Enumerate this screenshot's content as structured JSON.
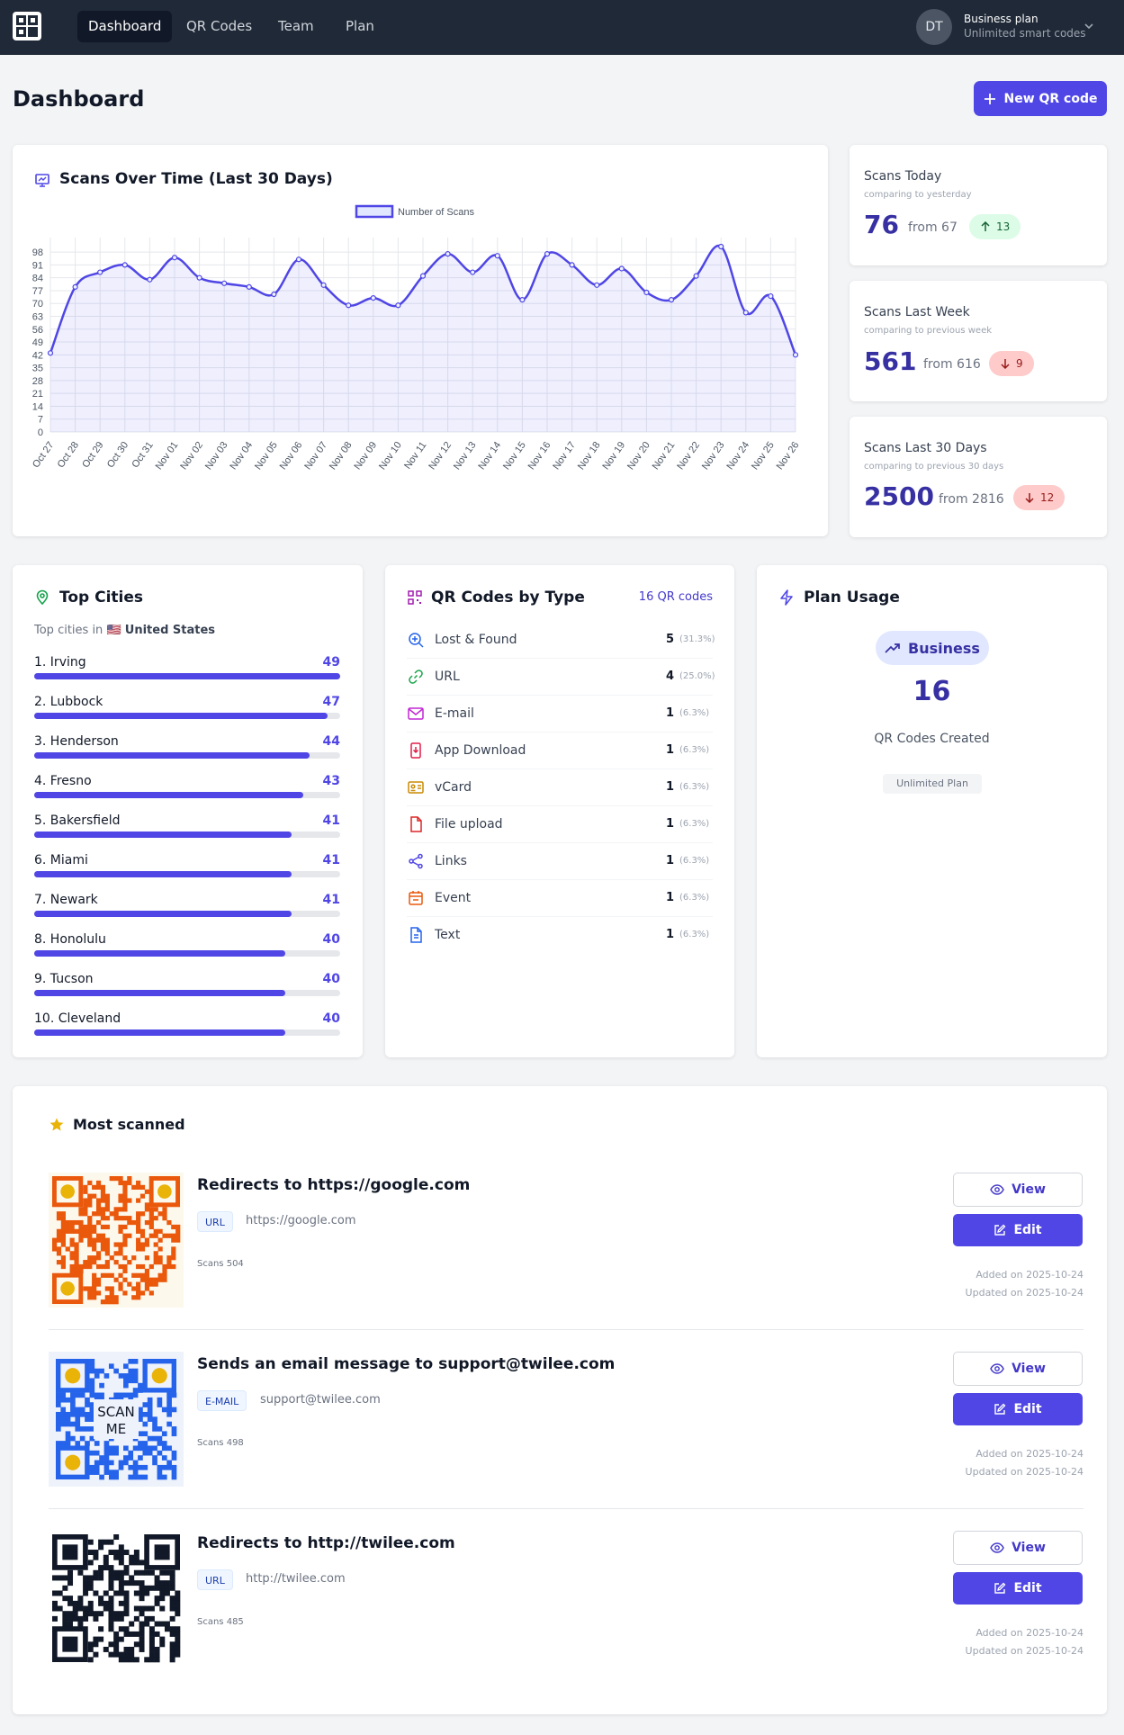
{
  "nav": {
    "links": [
      "Dashboard",
      "QR Codes",
      "Team",
      "Plan"
    ],
    "avatar_initials": "DT",
    "plan_name": "Business plan",
    "plan_sub": "Unlimited smart codes"
  },
  "header": {
    "title": "Dashboard",
    "new_button": "New QR code"
  },
  "scans_chart": {
    "title": "Scans Over Time (Last 30 Days)"
  },
  "chart_data": {
    "type": "area",
    "title": "Scans Over Time (Last 30 Days)",
    "legend": "Number of Scans",
    "legend_position": "top",
    "grid": true,
    "x": [
      "Oct 27",
      "Oct 28",
      "Oct 29",
      "Oct 30",
      "Oct 31",
      "Nov 01",
      "Nov 02",
      "Nov 03",
      "Nov 04",
      "Nov 05",
      "Nov 06",
      "Nov 07",
      "Nov 08",
      "Nov 09",
      "Nov 10",
      "Nov 11",
      "Nov 12",
      "Nov 13",
      "Nov 14",
      "Nov 15",
      "Nov 16",
      "Nov 17",
      "Nov 18",
      "Nov 19",
      "Nov 20",
      "Nov 21",
      "Nov 22",
      "Nov 23",
      "Nov 24",
      "Nov 25",
      "Nov 26"
    ],
    "series": [
      {
        "name": "Number of Scans",
        "values": [
          43,
          79,
          87,
          91,
          83,
          95,
          84,
          81,
          79,
          75,
          94,
          80,
          69,
          73,
          69,
          85,
          97,
          87,
          96,
          72,
          97,
          91,
          80,
          89,
          76,
          72,
          85,
          101,
          65,
          74,
          42
        ]
      }
    ],
    "yticks": [
      0,
      7,
      14,
      21,
      28,
      35,
      42,
      49,
      56,
      63,
      70,
      77,
      84,
      91,
      98
    ],
    "ylim": [
      0,
      101
    ],
    "color": "#4f46e5"
  },
  "stats": [
    {
      "title": "Scans Today",
      "sub": "comparing to yesterday",
      "value": "76",
      "from": "from 67",
      "delta": "13",
      "direction": "up"
    },
    {
      "title": "Scans Last Week",
      "sub": "comparing to previous week",
      "value": "561",
      "from": "from 616",
      "delta": "9",
      "direction": "down"
    },
    {
      "title": "Scans Last 30 Days",
      "sub": "comparing to previous 30 days",
      "value": "2500",
      "from": "from 2816",
      "delta": "12",
      "direction": "down"
    }
  ],
  "top_cities": {
    "title": "Top Cities",
    "sub_prefix": "Top cities in",
    "flag": "🇺🇸",
    "country": "United States",
    "items": [
      {
        "name": "1. Irving",
        "value": "49",
        "fraction": 1.0
      },
      {
        "name": "2. Lubbock",
        "value": "47",
        "fraction": 0.96
      },
      {
        "name": "3. Henderson",
        "value": "44",
        "fraction": 0.9
      },
      {
        "name": "4. Fresno",
        "value": "43",
        "fraction": 0.88
      },
      {
        "name": "5. Bakersfield",
        "value": "41",
        "fraction": 0.84
      },
      {
        "name": "6. Miami",
        "value": "41",
        "fraction": 0.84
      },
      {
        "name": "7. Newark",
        "value": "41",
        "fraction": 0.84
      },
      {
        "name": "8. Honolulu",
        "value": "40",
        "fraction": 0.82
      },
      {
        "name": "9. Tucson",
        "value": "40",
        "fraction": 0.82
      },
      {
        "name": "10. Cleveland",
        "value": "40",
        "fraction": 0.82
      }
    ]
  },
  "qr_types": {
    "title": "QR Codes by Type",
    "total": "16 QR codes",
    "items": [
      {
        "name": "Lost & Found",
        "count": "5",
        "pct": "(31.3%)",
        "icon": "search-plus-icon",
        "color": "#2563eb"
      },
      {
        "name": "URL",
        "count": "4",
        "pct": "(25.0%)",
        "icon": "link-icon",
        "color": "#16a34a"
      },
      {
        "name": "E-mail",
        "count": "1",
        "pct": "(6.3%)",
        "icon": "mail-icon",
        "color": "#c026d3"
      },
      {
        "name": "App Download",
        "count": "1",
        "pct": "(6.3%)",
        "icon": "phone-icon",
        "color": "#e11d48"
      },
      {
        "name": "vCard",
        "count": "1",
        "pct": "(6.3%)",
        "icon": "id-card-icon",
        "color": "#ca8a04"
      },
      {
        "name": "File upload",
        "count": "1",
        "pct": "(6.3%)",
        "icon": "file-icon",
        "color": "#dc2626"
      },
      {
        "name": "Links",
        "count": "1",
        "pct": "(6.3%)",
        "icon": "share-icon",
        "color": "#4f46e5"
      },
      {
        "name": "Event",
        "count": "1",
        "pct": "(6.3%)",
        "icon": "calendar-icon",
        "color": "#ea580c"
      },
      {
        "name": "Text",
        "count": "1",
        "pct": "(6.3%)",
        "icon": "document-icon",
        "color": "#2563eb"
      }
    ]
  },
  "plan_usage": {
    "title": "Plan Usage",
    "plan": "Business",
    "count": "16",
    "count_label": "QR Codes Created",
    "limit": "Unlimited Plan"
  },
  "most_scanned": {
    "title": "Most scanned",
    "view_label": "View",
    "edit_label": "Edit",
    "items": [
      {
        "title": "Redirects to https://google.com",
        "tag": "URL",
        "url": "https://google.com",
        "scans": "Scans 504",
        "added": "Added on 2025-10-24",
        "updated": "Updated on 2025-10-24",
        "qr_style": "orange-circle"
      },
      {
        "title": "Sends an email message to support@twilee.com",
        "tag": "E-MAIL",
        "url": "support@twilee.com",
        "scans": "Scans 498",
        "added": "Added on 2025-10-24",
        "updated": "Updated on 2025-10-24",
        "qr_style": "blue-scan-me",
        "qr_text_1": "SCAN",
        "qr_text_2": "ME"
      },
      {
        "title": "Redirects to http://twilee.com",
        "tag": "URL",
        "url": "http://twilee.com",
        "scans": "Scans 485",
        "added": "Added on 2025-10-24",
        "updated": "Updated on 2025-10-24",
        "qr_style": "black-classic"
      }
    ]
  }
}
